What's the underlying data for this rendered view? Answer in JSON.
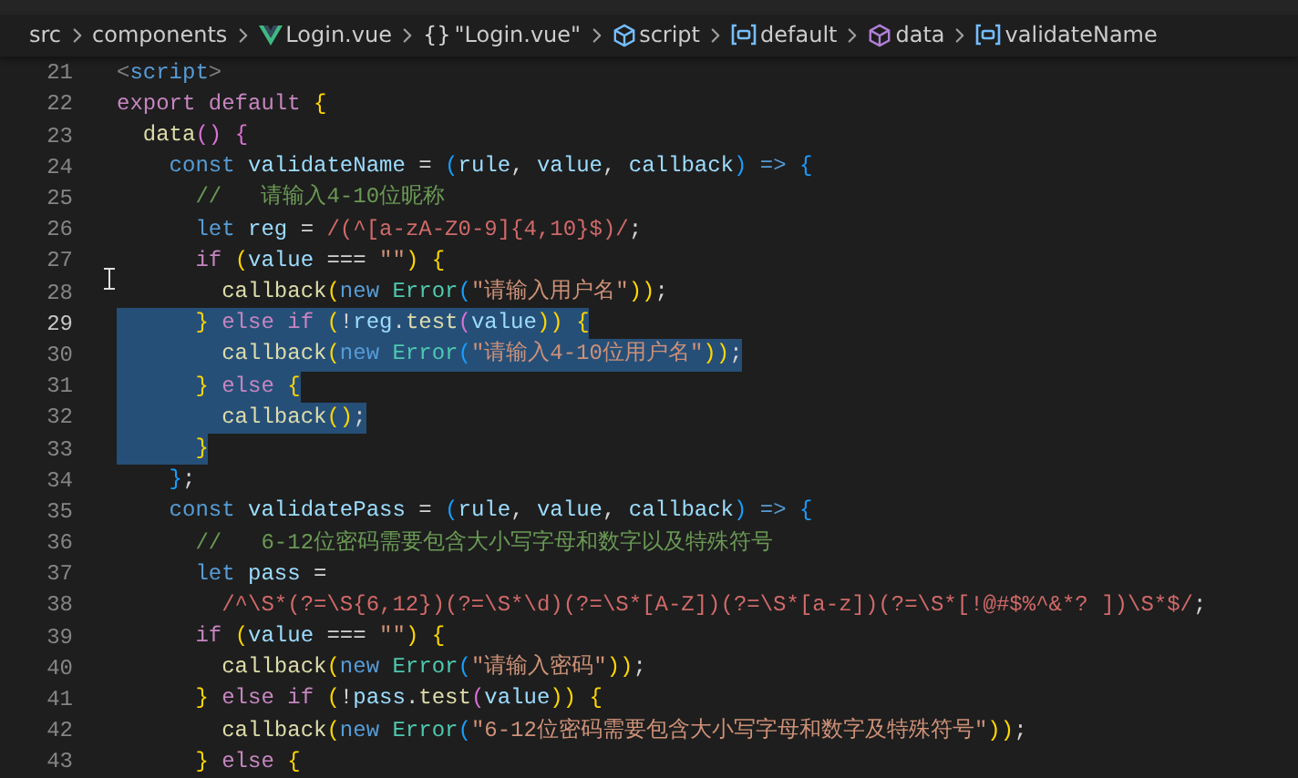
{
  "breadcrumb": [
    {
      "label": "src",
      "kind": "folder"
    },
    {
      "label": "components",
      "kind": "folder"
    },
    {
      "label": "Login.vue",
      "kind": "vue"
    },
    {
      "label": "\"Login.vue\"",
      "kind": "braces",
      "symbol": "{}"
    },
    {
      "label": "script",
      "kind": "module"
    },
    {
      "label": "default",
      "kind": "variable"
    },
    {
      "label": "data",
      "kind": "method"
    },
    {
      "label": "validateName",
      "kind": "variable"
    }
  ],
  "lines": [
    {
      "number": "21",
      "current": false,
      "selected": false,
      "tokens": [
        {
          "text": "<",
          "kind": "tag"
        },
        {
          "text": "script",
          "kind": "kw"
        },
        {
          "text": ">",
          "kind": "tag"
        }
      ]
    },
    {
      "number": "22",
      "current": false,
      "selected": false,
      "tokens": [
        {
          "text": "export default ",
          "kind": "ctl"
        },
        {
          "text": "{",
          "kind": "br1"
        }
      ]
    },
    {
      "number": "23",
      "current": false,
      "selected": false,
      "tokens": [
        {
          "text": "  data",
          "kind": "fn"
        },
        {
          "text": "() {",
          "kind": "br2"
        }
      ]
    },
    {
      "number": "24",
      "current": false,
      "selected": false,
      "tokens": [
        {
          "text": "    const ",
          "kind": "kw"
        },
        {
          "text": "validateName",
          "kind": "var"
        },
        {
          "text": " = ",
          "kind": "pun"
        },
        {
          "text": "(",
          "kind": "br3"
        },
        {
          "text": "rule",
          "kind": "var"
        },
        {
          "text": ", ",
          "kind": "pun"
        },
        {
          "text": "value",
          "kind": "var"
        },
        {
          "text": ", ",
          "kind": "pun"
        },
        {
          "text": "callback",
          "kind": "var"
        },
        {
          "text": ") ",
          "kind": "br3"
        },
        {
          "text": "=> ",
          "kind": "kw"
        },
        {
          "text": "{",
          "kind": "br3"
        }
      ]
    },
    {
      "number": "25",
      "current": false,
      "selected": false,
      "tokens": [
        {
          "text": "      //   请输入4-10位昵称",
          "kind": "cmt"
        }
      ]
    },
    {
      "number": "26",
      "current": false,
      "selected": false,
      "tokens": [
        {
          "text": "      let ",
          "kind": "kw"
        },
        {
          "text": "reg",
          "kind": "var"
        },
        {
          "text": " = ",
          "kind": "pun"
        },
        {
          "text": "/(^[a-zA-Z0-9]{4,10}$)/",
          "kind": "re"
        },
        {
          "text": ";",
          "kind": "pun"
        }
      ]
    },
    {
      "number": "27",
      "current": false,
      "selected": false,
      "tokens": [
        {
          "text": "      if ",
          "kind": "ctl"
        },
        {
          "text": "(",
          "kind": "br1"
        },
        {
          "text": "value",
          "kind": "var"
        },
        {
          "text": " === ",
          "kind": "pun"
        },
        {
          "text": "\"\"",
          "kind": "str"
        },
        {
          "text": ") {",
          "kind": "br1"
        }
      ]
    },
    {
      "number": "28",
      "current": false,
      "selected": false,
      "tokens": [
        {
          "text": "        callback",
          "kind": "fn"
        },
        {
          "text": "(",
          "kind": "br1"
        },
        {
          "text": "new ",
          "kind": "kw"
        },
        {
          "text": "Error",
          "kind": "cls"
        },
        {
          "text": "(",
          "kind": "br3"
        },
        {
          "text": "\"请输入用户名\"",
          "kind": "str"
        },
        {
          "text": "))",
          "kind": "br1"
        },
        {
          "text": ";",
          "kind": "pun"
        }
      ]
    },
    {
      "number": "29",
      "current": true,
      "selected": true,
      "tokens": [
        {
          "text": "      } ",
          "kind": "br1"
        },
        {
          "text": "else if ",
          "kind": "ctl"
        },
        {
          "text": "(",
          "kind": "br1"
        },
        {
          "text": "!",
          "kind": "pun"
        },
        {
          "text": "reg",
          "kind": "var"
        },
        {
          "text": ".",
          "kind": "pun"
        },
        {
          "text": "test",
          "kind": "fn"
        },
        {
          "text": "(",
          "kind": "br2"
        },
        {
          "text": "value",
          "kind": "var"
        },
        {
          "text": ")) {",
          "kind": "br1"
        }
      ]
    },
    {
      "number": "30",
      "current": false,
      "selected": true,
      "tokens": [
        {
          "text": "        callback",
          "kind": "fn"
        },
        {
          "text": "(",
          "kind": "br1"
        },
        {
          "text": "new ",
          "kind": "kw"
        },
        {
          "text": "Error",
          "kind": "cls"
        },
        {
          "text": "(",
          "kind": "br3"
        },
        {
          "text": "\"请输入4-10位用户名\"",
          "kind": "str"
        },
        {
          "text": "))",
          "kind": "br1"
        },
        {
          "text": ";",
          "kind": "pun"
        }
      ]
    },
    {
      "number": "31",
      "current": false,
      "selected": true,
      "tokens": [
        {
          "text": "      } ",
          "kind": "br1"
        },
        {
          "text": "else ",
          "kind": "ctl"
        },
        {
          "text": "{",
          "kind": "br1"
        }
      ]
    },
    {
      "number": "32",
      "current": false,
      "selected": true,
      "tokens": [
        {
          "text": "        callback",
          "kind": "fn"
        },
        {
          "text": "()",
          "kind": "br1"
        },
        {
          "text": ";",
          "kind": "pun"
        }
      ]
    },
    {
      "number": "33",
      "current": false,
      "selected": true,
      "tokens": [
        {
          "text": "      }",
          "kind": "br1"
        }
      ]
    },
    {
      "number": "34",
      "current": false,
      "selected": false,
      "tokens": [
        {
          "text": "    }",
          "kind": "br3"
        },
        {
          "text": ";",
          "kind": "pun"
        }
      ]
    },
    {
      "number": "35",
      "current": false,
      "selected": false,
      "tokens": [
        {
          "text": "    const ",
          "kind": "kw"
        },
        {
          "text": "validatePass",
          "kind": "var"
        },
        {
          "text": " = ",
          "kind": "pun"
        },
        {
          "text": "(",
          "kind": "br3"
        },
        {
          "text": "rule",
          "kind": "var"
        },
        {
          "text": ", ",
          "kind": "pun"
        },
        {
          "text": "value",
          "kind": "var"
        },
        {
          "text": ", ",
          "kind": "pun"
        },
        {
          "text": "callback",
          "kind": "var"
        },
        {
          "text": ") ",
          "kind": "br3"
        },
        {
          "text": "=> ",
          "kind": "kw"
        },
        {
          "text": "{",
          "kind": "br3"
        }
      ]
    },
    {
      "number": "36",
      "current": false,
      "selected": false,
      "tokens": [
        {
          "text": "      //   6-12位密码需要包含大小写字母和数字以及特殊符号",
          "kind": "cmt"
        }
      ]
    },
    {
      "number": "37",
      "current": false,
      "selected": false,
      "tokens": [
        {
          "text": "      let ",
          "kind": "kw"
        },
        {
          "text": "pass",
          "kind": "var"
        },
        {
          "text": " =",
          "kind": "pun"
        }
      ]
    },
    {
      "number": "38",
      "current": false,
      "selected": false,
      "tokens": [
        {
          "text": "        /^\\S*(?=\\S{6,12})(?=\\S*\\d)(?=\\S*[A-Z])(?=\\S*[a-z])(?=\\S*[!@#$%^&*? ])\\S*$/",
          "kind": "re"
        },
        {
          "text": ";",
          "kind": "pun"
        }
      ]
    },
    {
      "number": "39",
      "current": false,
      "selected": false,
      "tokens": [
        {
          "text": "      if ",
          "kind": "ctl"
        },
        {
          "text": "(",
          "kind": "br1"
        },
        {
          "text": "value",
          "kind": "var"
        },
        {
          "text": " === ",
          "kind": "pun"
        },
        {
          "text": "\"\"",
          "kind": "str"
        },
        {
          "text": ") {",
          "kind": "br1"
        }
      ]
    },
    {
      "number": "40",
      "current": false,
      "selected": false,
      "tokens": [
        {
          "text": "        callback",
          "kind": "fn"
        },
        {
          "text": "(",
          "kind": "br1"
        },
        {
          "text": "new ",
          "kind": "kw"
        },
        {
          "text": "Error",
          "kind": "cls"
        },
        {
          "text": "(",
          "kind": "br3"
        },
        {
          "text": "\"请输入密码\"",
          "kind": "str"
        },
        {
          "text": "))",
          "kind": "br1"
        },
        {
          "text": ";",
          "kind": "pun"
        }
      ]
    },
    {
      "number": "41",
      "current": false,
      "selected": false,
      "tokens": [
        {
          "text": "      } ",
          "kind": "br1"
        },
        {
          "text": "else if ",
          "kind": "ctl"
        },
        {
          "text": "(",
          "kind": "br1"
        },
        {
          "text": "!",
          "kind": "pun"
        },
        {
          "text": "pass",
          "kind": "var"
        },
        {
          "text": ".",
          "kind": "pun"
        },
        {
          "text": "test",
          "kind": "fn"
        },
        {
          "text": "(",
          "kind": "br2"
        },
        {
          "text": "value",
          "kind": "var"
        },
        {
          "text": ")) {",
          "kind": "br1"
        }
      ]
    },
    {
      "number": "42",
      "current": false,
      "selected": false,
      "tokens": [
        {
          "text": "        callback",
          "kind": "fn"
        },
        {
          "text": "(",
          "kind": "br1"
        },
        {
          "text": "new ",
          "kind": "kw"
        },
        {
          "text": "Error",
          "kind": "cls"
        },
        {
          "text": "(",
          "kind": "br3"
        },
        {
          "text": "\"6-12位密码需要包含大小写字母和数字及特殊符号\"",
          "kind": "str"
        },
        {
          "text": "))",
          "kind": "br1"
        },
        {
          "text": ";",
          "kind": "pun"
        }
      ]
    },
    {
      "number": "43",
      "current": false,
      "selected": false,
      "tokens": [
        {
          "text": "      } ",
          "kind": "br1"
        },
        {
          "text": "else ",
          "kind": "ctl"
        },
        {
          "text": "{",
          "kind": "br1"
        }
      ]
    }
  ]
}
